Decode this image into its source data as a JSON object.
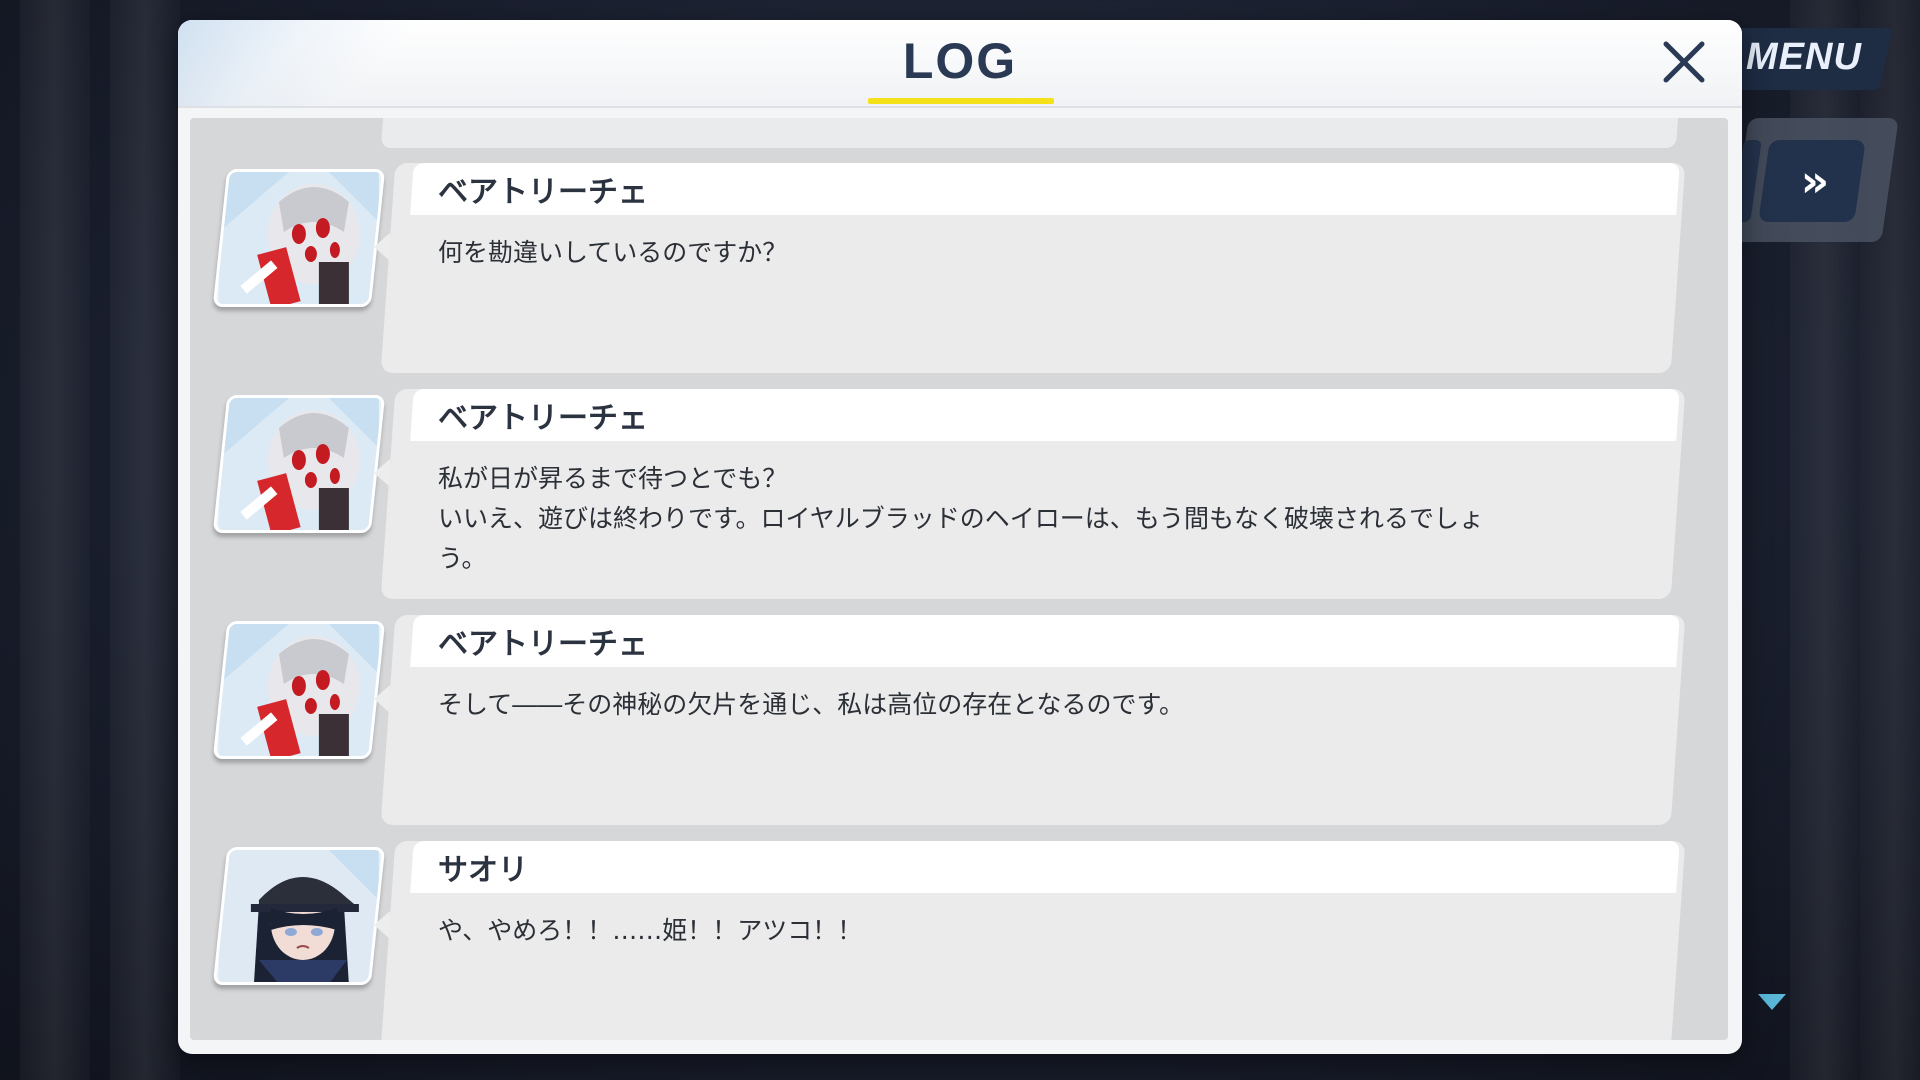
{
  "menu": {
    "label": "MENU",
    "fast_forward_icon": "double-chevron-right-icon"
  },
  "log": {
    "title": "LOG",
    "close_icon": "close-icon",
    "entries": [
      {
        "speaker": "ベアトリーチェ",
        "text": "何を勘違いしているのですか？",
        "portrait": "beatrice"
      },
      {
        "speaker": "ベアトリーチェ",
        "text": "私が日が昇るまで待つとでも？\nいいえ、遊びは終わりです。ロイヤルブラッドのヘイローは、もう間もなく破壊されるでしょ\nう。",
        "portrait": "beatrice"
      },
      {
        "speaker": "ベアトリーチェ",
        "text": "そして――その神秘の欠片を通じ、私は高位の存在となるのです。",
        "portrait": "beatrice"
      },
      {
        "speaker": "サオリ",
        "text": "や、やめろ！！……姫！！アツコ！！",
        "portrait": "saori"
      }
    ]
  },
  "colors": {
    "title_underline": "#f5e11a",
    "title": "#2a3a55",
    "scroll_arrow": "#5ab7d8"
  }
}
